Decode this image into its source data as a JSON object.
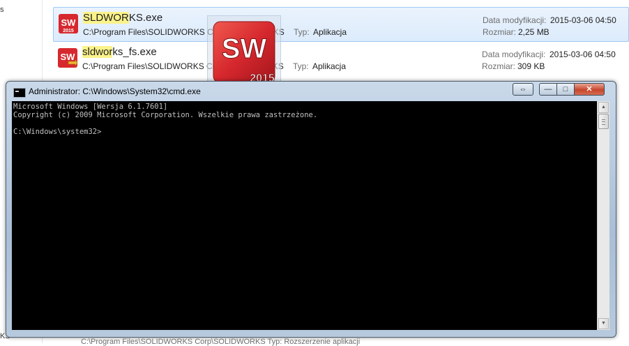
{
  "left_pane": {
    "top_text": "s",
    "bottom_text": "KS"
  },
  "results": [
    {
      "name_highlight": "SLDWOR",
      "name_rest": "KS.exe",
      "path": "C:\\Program Files\\SOLIDWORKS Corp\\SOLIDWORKS",
      "type_label": "Typ:",
      "type_value": "Aplikacja",
      "modified_label": "Data modyfikacji:",
      "modified_value": "2015-03-06 04:50",
      "size_label": "Rozmiar:",
      "size_value": "2,25 MB",
      "selected": true
    },
    {
      "name_highlight": "sldwor",
      "name_rest": "ks_fs.exe",
      "path": "C:\\Program Files\\SOLIDWORKS Corp\\SOLIDWORKS",
      "type_label": "Typ:",
      "type_value": "Aplikacja",
      "modified_label": "Data modyfikacji:",
      "modified_value": "2015-03-06 04:50",
      "size_label": "Rozmiar:",
      "size_value": "309 KB",
      "selected": false
    }
  ],
  "drag_icon": {
    "letters": "SW",
    "year": "2015"
  },
  "cmd": {
    "title": "Administrator: C:\\Windows\\System32\\cmd.exe",
    "console_text": "Microsoft Windows [Wersja 6.1.7601]\nCopyright (c) 2009 Microsoft Corporation. Wszelkie prawa zastrzeżone.\n\nC:\\Windows\\system32>",
    "buttons": {
      "resize": "⇔",
      "minimize": "—",
      "maximize": "□",
      "close": "✕"
    }
  },
  "bottom_strip_text": "C:\\Program Files\\SOLIDWORKS Corp\\SOLIDWORKS     Typ: Rozszerzenie aplikacji",
  "colors": {
    "selection": "#dcebfc",
    "highlight": "#fbf38a",
    "sw_red": "#d6282e",
    "console_bg": "#000000",
    "console_fg": "#c0c0c0",
    "close_red": "#c7462c"
  },
  "icons": {
    "file_icon": "solidworks-app-icon",
    "drag": "solidworks-2015-logo-icon",
    "cmd": "cmd-prompt-icon"
  }
}
